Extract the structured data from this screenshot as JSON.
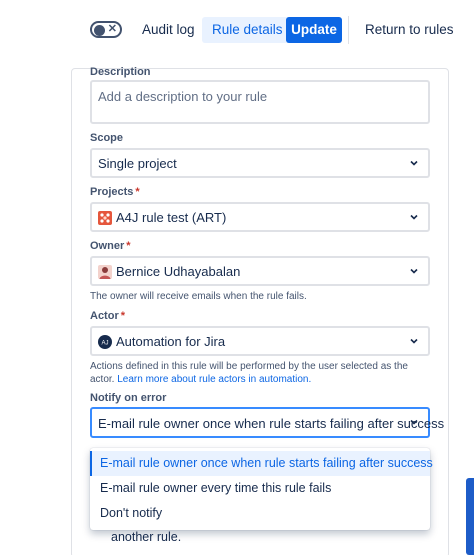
{
  "toolbar": {
    "toggle_state": "off",
    "audit_log": "Audit log",
    "rule_details": "Rule details",
    "update": "Update",
    "return_to_rules": "Return to rules"
  },
  "form": {
    "description": {
      "label": "Description",
      "placeholder": "Add a description to your rule"
    },
    "scope": {
      "label": "Scope",
      "value": "Single project"
    },
    "projects": {
      "label": "Projects",
      "value": "A4J rule test (ART)"
    },
    "owner": {
      "label": "Owner",
      "value": "Bernice Udhayabalan",
      "help": "The owner will receive emails when the rule fails."
    },
    "actor": {
      "label": "Actor",
      "value": "Automation for Jira",
      "avatar_text": "AJ",
      "help": "Actions defined in this rule will be performed by the user selected as the actor.",
      "help_link": "Learn more about rule actors in automation."
    },
    "notify": {
      "label": "Notify on error",
      "value": "E-mail rule owner once when rule starts failing after success",
      "options": [
        "E-mail rule owner once when rule starts failing after success",
        "E-mail rule owner every time this rule fails",
        "Don't notify"
      ],
      "selected_index": 0
    },
    "required_marker": "*",
    "below_menu_text": "another rule."
  },
  "colors": {
    "primary": "#0c66e4",
    "selected_bg": "#e9f2ff",
    "required": "#c9372c"
  }
}
